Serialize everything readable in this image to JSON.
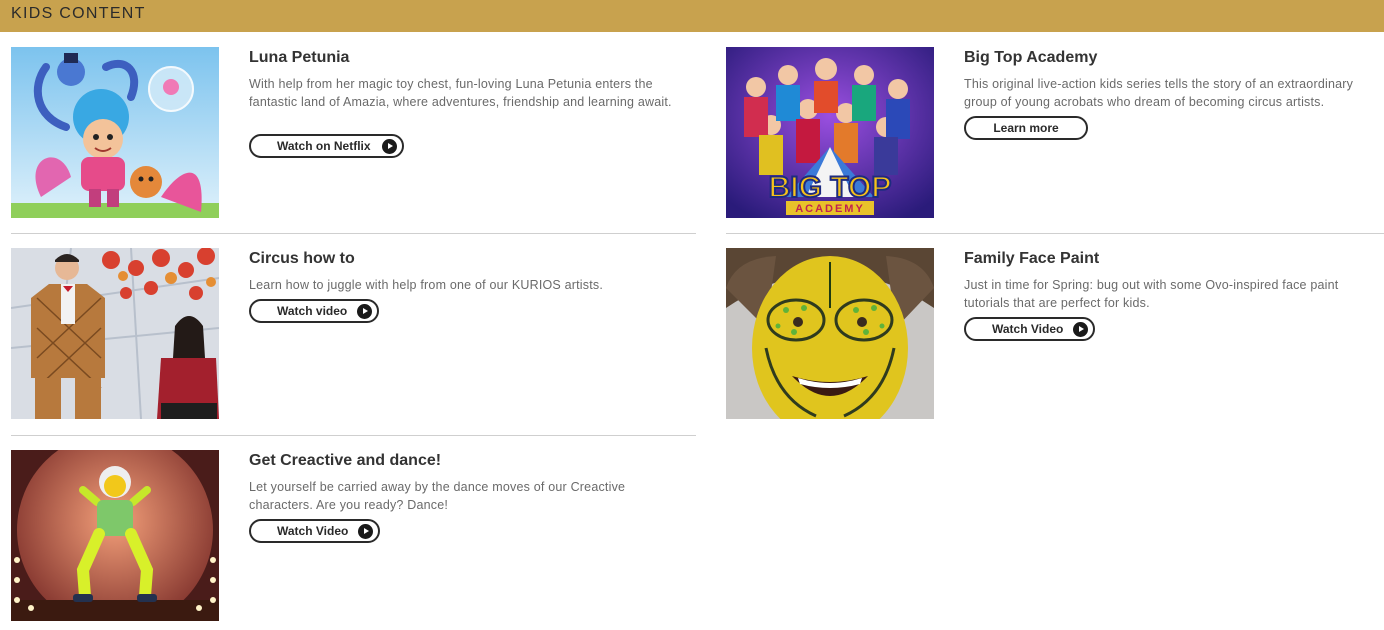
{
  "header": {
    "title": "KIDS CONTENT"
  },
  "cards": [
    {
      "title": "Luna Petunia",
      "description": "With help from her magic toy chest, fun-loving Luna Petunia enters the fantastic land of Amazia, where adventures, friendship and learning await.",
      "button": "Watch on Netflix"
    },
    {
      "title": "Big Top Academy",
      "description": "This original live-action kids series tells the story of an extraordinary group of young acrobats who dream of becoming circus artists.",
      "button": "Learn more",
      "logo_text": {
        "top": "BIG TOP",
        "bottom": "ACADEMY"
      }
    },
    {
      "title": "Circus how to",
      "description": "Learn how to juggle with help from one of our KURIOS artists.",
      "button": "Watch video"
    },
    {
      "title": "Family Face Paint",
      "description": "Just in time for Spring: bug out with some Ovo-inspired face paint tutorials that are perfect for kids.",
      "button": "Watch Video"
    },
    {
      "title": "Get Creactive and dance!",
      "description": "Let yourself be carried away by the dance moves of our Creactive characters. Are you ready? Dance!",
      "button": "Watch Video"
    }
  ],
  "icons": {
    "button_icon": "play-icon"
  },
  "colors": {
    "header_bg": "#c8a24e",
    "button_border": "#2a2a2a"
  }
}
